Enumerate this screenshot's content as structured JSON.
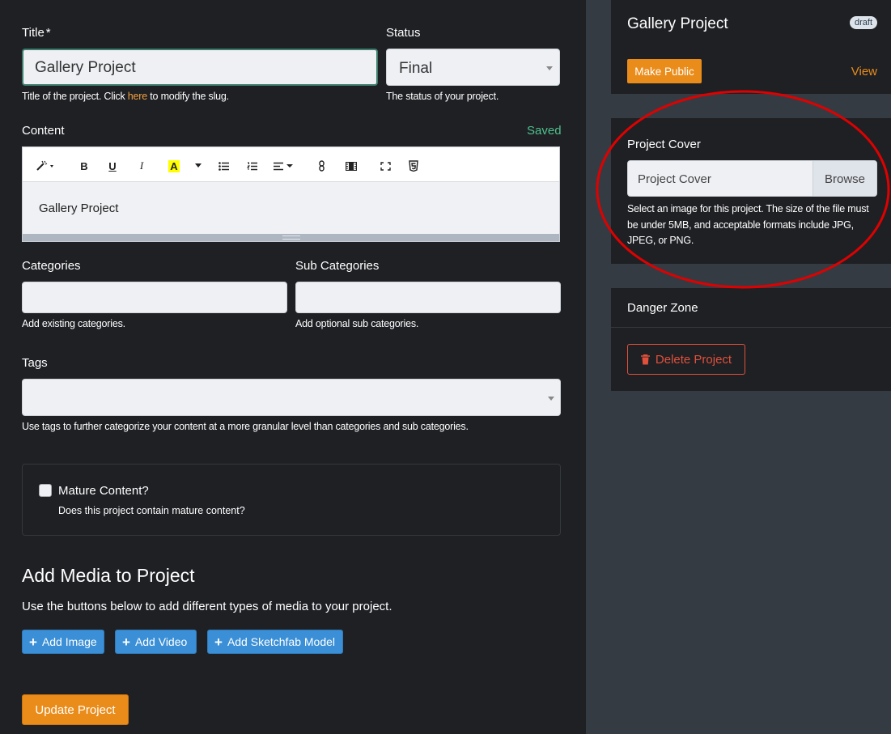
{
  "form": {
    "title_label": "Title",
    "title_required": "*",
    "title_value": "Gallery Project",
    "title_help_prefix": "Title of the project. Click ",
    "title_help_link": "here",
    "title_help_suffix": " to modify the slug.",
    "status_label": "Status",
    "status_value": "Final",
    "status_help": "The status of your project.",
    "content_label": "Content",
    "content_saved": "Saved",
    "content_body": "Gallery Project",
    "categories_label": "Categories",
    "categories_help": "Add existing categories.",
    "subcategories_label": "Sub Categories",
    "subcategories_help": "Add optional sub categories.",
    "tags_label": "Tags",
    "tags_help": "Use tags to further categorize your content at a more granular level than categories and sub categories.",
    "mature_label": "Mature Content?",
    "mature_help": "Does this project contain mature content?",
    "mature_checked": false
  },
  "editor_toolbar": {
    "items": [
      "magic-wand-icon",
      "bold-icon",
      "underline-icon",
      "italic-icon",
      "font-color-icon",
      "unordered-list-icon",
      "ordered-list-icon",
      "paragraph-align-icon",
      "link-icon",
      "video-icon",
      "fullscreen-icon",
      "html5-code-icon"
    ],
    "bold": "B",
    "underline": "U",
    "italic": "I",
    "color": "A",
    "highlight_color": "#ffff00"
  },
  "media": {
    "heading": "Add Media to Project",
    "description": "Use the buttons below to add different types of media to your project.",
    "add_image": "Add Image",
    "add_video": "Add Video",
    "add_sketchfab": "Add Sketchfab Model"
  },
  "update_button": "Update Project",
  "sidebar": {
    "project_title": "Gallery Project",
    "badge": "draft",
    "make_public": "Make Public",
    "view": "View",
    "cover_title": "Project Cover",
    "cover_placeholder": "Project Cover",
    "browse": "Browse",
    "cover_help": "Select an image for this project. The size of the file must be under 5MB, and acceptable formats include JPG, JPEG, or PNG.",
    "danger_title": "Danger Zone",
    "delete_button": "Delete Project"
  },
  "colors": {
    "accent_orange": "#ea8c1a",
    "saved_green": "#4fc08d",
    "danger_red": "#e0503a",
    "button_blue": "#3a8fd6",
    "annotation_red": "#e00000"
  }
}
